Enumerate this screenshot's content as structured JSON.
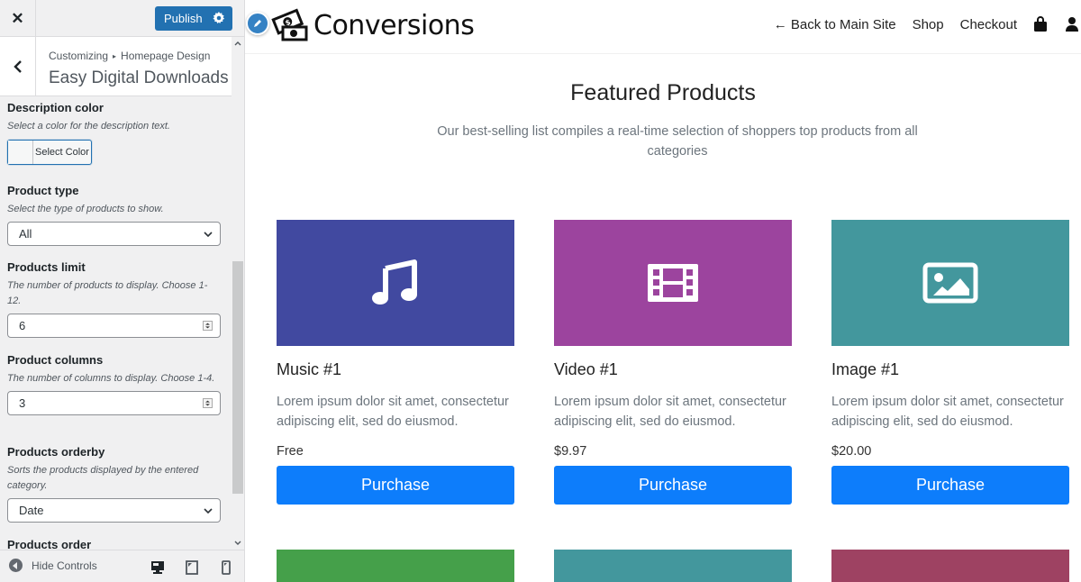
{
  "sidebar": {
    "close_label": "✕",
    "publish_label": "Publish",
    "breadcrumb": {
      "root": "Customizing",
      "separator": "▸",
      "section": "Homepage Design"
    },
    "panel_title": "Easy Digital Downloads",
    "controls": [
      {
        "label": "Description color",
        "description": "Select a color for the description text.",
        "type": "color",
        "button_label": "Select Color"
      },
      {
        "label": "Product type",
        "description": "Select the type of products to show.",
        "type": "select",
        "value": "All"
      },
      {
        "label": "Products limit",
        "description": "The number of products to display. Choose 1-12.",
        "type": "number",
        "value": "6"
      },
      {
        "label": "Product columns",
        "description": "The number of columns to display. Choose 1-4.",
        "type": "number",
        "value": "3"
      },
      {
        "label": "Products orderby",
        "description": "Sorts the products displayed by the entered category.",
        "type": "select",
        "value": "Date"
      },
      {
        "label": "Products order"
      }
    ],
    "footer": {
      "hide_controls_label": "Hide Controls",
      "devices": [
        "desktop-icon",
        "tablet-icon",
        "mobile-icon"
      ]
    }
  },
  "preview": {
    "site_name": "Conversions",
    "nav": {
      "back_label": "← Back to Main Site",
      "shop_label": "Shop",
      "checkout_label": "Checkout"
    },
    "section": {
      "title": "Featured Products",
      "subtitle": "Our best-selling list compiles a real-time selection of shoppers top products from all categories"
    },
    "products": [
      {
        "name": "Music #1",
        "description": "Lorem ipsum dolor sit amet, consectetur adipiscing elit, sed do eiusmod.",
        "price": "Free",
        "button": "Purchase",
        "icon": "music-note-icon",
        "color": "#4149a0"
      },
      {
        "name": "Video #1",
        "description": "Lorem ipsum dolor sit amet, consectetur adipiscing elit, sed do eiusmod.",
        "price": "$9.97",
        "button": "Purchase",
        "icon": "film-icon",
        "color": "#9c449e"
      },
      {
        "name": "Image #1",
        "description": "Lorem ipsum dolor sit amet, consectetur adipiscing elit, sed do eiusmod.",
        "price": "$20.00",
        "button": "Purchase",
        "icon": "image-icon",
        "color": "#43979d"
      }
    ],
    "next_row_colors": [
      "#45a04a",
      "#43979d",
      "#9e4262"
    ]
  },
  "colors": {
    "publish": "#2271b1",
    "purchase": "#0d7dfb"
  }
}
